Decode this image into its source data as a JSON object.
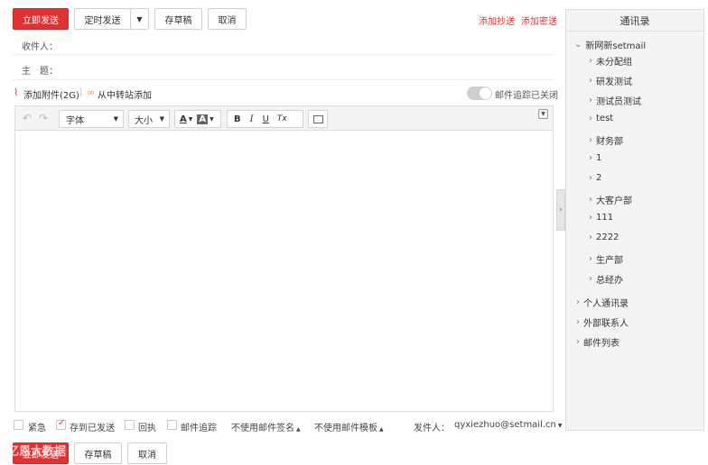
{
  "toolbar": {
    "send_now": "立即发送",
    "schedule_send": "定时发送",
    "save_draft": "存草稿",
    "cancel": "取消",
    "add_cc": "添加抄送",
    "add_bcc": "添加密送"
  },
  "form": {
    "recipient_label": "收件人：",
    "subject_label": "主　题："
  },
  "attachments": {
    "add_attachment": "添加附件(2G)",
    "separator": "|",
    "add_from_transfer": "从中转站添加",
    "tracking_status": "邮件追踪已关闭"
  },
  "editor": {
    "font_label": "字体",
    "size_label": "大小",
    "font_color": "A",
    "bg_color": "A",
    "bold": "B",
    "italic": "I",
    "underline": "U",
    "clear_format": "Tx"
  },
  "sidebar": {
    "title": "通讯录",
    "root": "新网新setmail",
    "groups": [
      "未分配组",
      "研发测试",
      "测试员测试",
      "test",
      "财务部",
      "1",
      "2",
      "大客户部",
      "111",
      "2222",
      "生产部",
      "总经办"
    ],
    "sections": [
      "个人通讯录",
      "外部联系人",
      "邮件列表"
    ]
  },
  "footer": {
    "urgent": "紧急",
    "save_to_sent": "存到已发送",
    "receipt": "回执",
    "mail_tracking": "邮件追踪",
    "no_signature": "不使用邮件签名",
    "no_template": "不使用邮件模板",
    "sender_label": "发件人：",
    "sender_value": "qyxiezhuo@setmail.cn",
    "watermark": "亿恩大数据"
  },
  "colors": {
    "primary": "#e03232",
    "sidebar_bg": "#f4f4f4"
  }
}
